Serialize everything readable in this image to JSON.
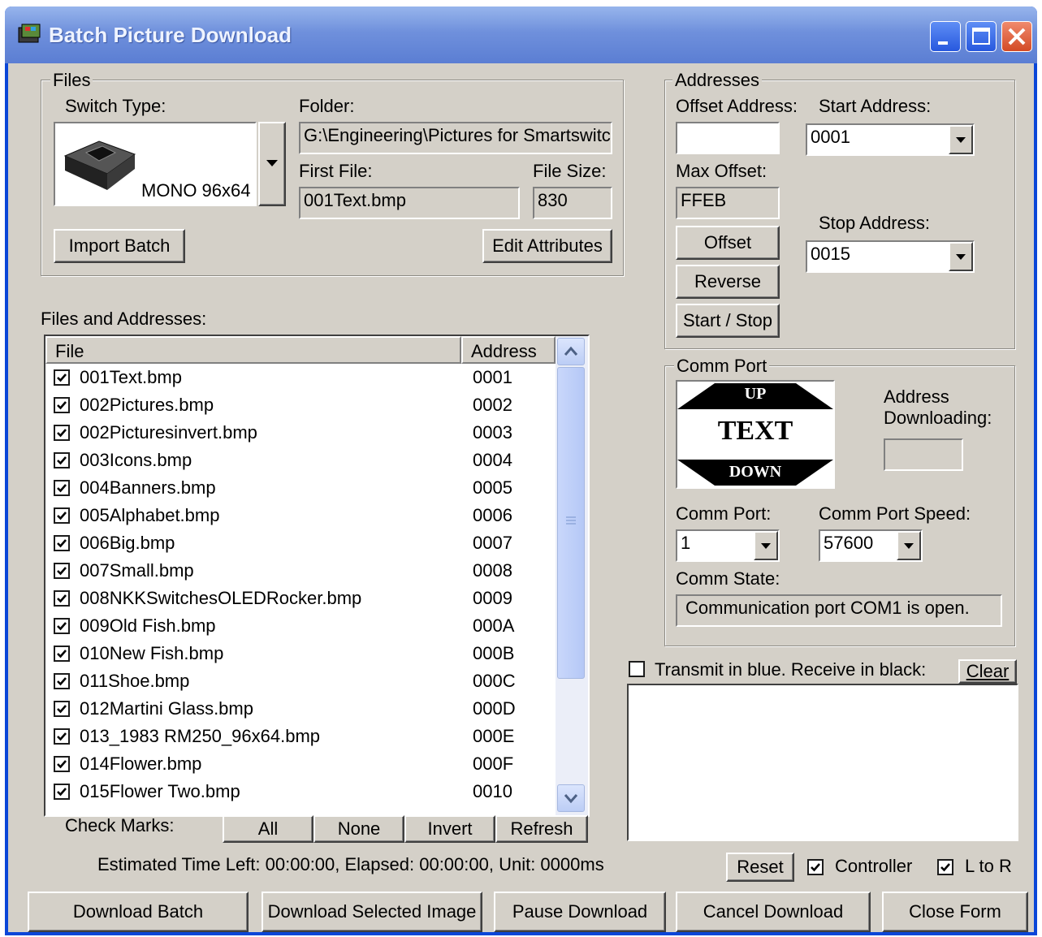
{
  "window": {
    "title": "Batch Picture Download"
  },
  "files_group": {
    "label": "Files",
    "switch_type_label": "Switch Type:",
    "switch_type_value": "MONO 96x64",
    "folder_label": "Folder:",
    "folder_value": "G:\\Engineering\\Pictures for Smartswitch",
    "first_file_label": "First File:",
    "first_file_value": "001Text.bmp",
    "file_size_label": "File Size:",
    "file_size_value": "830",
    "import_batch": "Import Batch",
    "edit_attributes": "Edit Attributes"
  },
  "addresses_group": {
    "label": "Addresses",
    "offset_address_label": "Offset Address:",
    "offset_address_value": "",
    "start_address_label": "Start Address:",
    "start_address_value": "0001",
    "max_offset_label": "Max Offset:",
    "max_offset_value": "FFEB",
    "stop_address_label": "Stop Address:",
    "stop_address_value": "0015",
    "offset_button": "Offset",
    "reverse_button": "Reverse",
    "start_stop_button": "Start / Stop"
  },
  "list": {
    "label": "Files and Addresses:",
    "col_file": "File",
    "col_address": "Address",
    "rows": [
      {
        "file": "001Text.bmp",
        "address": "0001",
        "checked": true
      },
      {
        "file": "002Pictures.bmp",
        "address": "0002",
        "checked": true
      },
      {
        "file": "002Picturesinvert.bmp",
        "address": "0003",
        "checked": true
      },
      {
        "file": "003Icons.bmp",
        "address": "0004",
        "checked": true
      },
      {
        "file": "004Banners.bmp",
        "address": "0005",
        "checked": true
      },
      {
        "file": "005Alphabet.bmp",
        "address": "0006",
        "checked": true
      },
      {
        "file": "006Big.bmp",
        "address": "0007",
        "checked": true
      },
      {
        "file": "007Small.bmp",
        "address": "0008",
        "checked": true
      },
      {
        "file": "008NKKSwitchesOLEDRocker.bmp",
        "address": "0009",
        "checked": true
      },
      {
        "file": "009Old Fish.bmp",
        "address": "000A",
        "checked": true
      },
      {
        "file": "010New Fish.bmp",
        "address": "000B",
        "checked": true
      },
      {
        "file": "011Shoe.bmp",
        "address": "000C",
        "checked": true
      },
      {
        "file": "012Martini Glass.bmp",
        "address": "000D",
        "checked": true
      },
      {
        "file": "013_1983 RM250_96x64.bmp",
        "address": "000E",
        "checked": true
      },
      {
        "file": "014Flower.bmp",
        "address": "000F",
        "checked": true
      },
      {
        "file": "015Flower Two.bmp",
        "address": "0010",
        "checked": true
      }
    ]
  },
  "check_marks": {
    "label": "Check Marks:",
    "all": "All",
    "none": "None",
    "invert": "Invert",
    "refresh": "Refresh"
  },
  "status_line": "Estimated Time Left: 00:00:00, Elapsed: 00:00:00, Unit: 0000ms",
  "comm_group": {
    "label": "Comm Port",
    "preview_up": "UP",
    "preview_text": "TEXT",
    "preview_down": "DOWN",
    "address_downloading_label_1": "Address",
    "address_downloading_label_2": "Downloading:",
    "address_downloading_value": "",
    "comm_port_label": "Comm Port:",
    "comm_port_value": "1",
    "comm_speed_label": "Comm Port Speed:",
    "comm_speed_value": "57600",
    "comm_state_label": "Comm State:",
    "comm_state_value": "Communication port COM1 is open."
  },
  "terminal": {
    "transmit_label": "Transmit in blue. Receive in black:",
    "transmit_checked": false,
    "clear": "Clear"
  },
  "options": {
    "reset": "Reset",
    "controller": "Controller",
    "controller_checked": true,
    "ltor": "L to R",
    "ltor_checked": true
  },
  "bottom": {
    "download_batch": "Download Batch",
    "download_selected": "Download Selected Image",
    "pause": "Pause  Download",
    "cancel": "Cancel Download",
    "close": "Close Form"
  }
}
